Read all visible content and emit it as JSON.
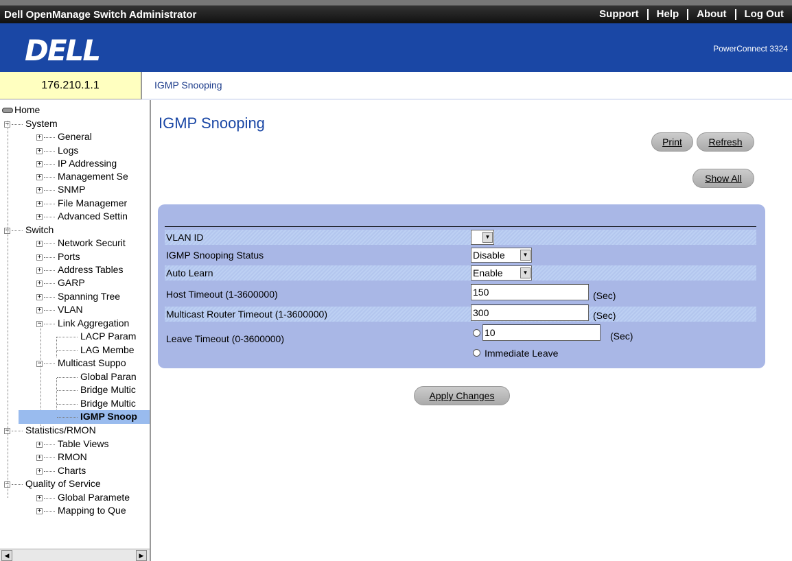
{
  "app": {
    "title": "Dell OpenManage Switch Administrator",
    "nav": [
      "Support",
      "Help",
      "About",
      "Log Out"
    ],
    "logo": "DELL",
    "product": "PowerConnect 3324"
  },
  "ip_address": "176.210.1.1",
  "breadcrumb": "IGMP Snooping",
  "tree": {
    "home": "Home",
    "system": "System",
    "system_items": [
      "General",
      "Logs",
      "IP Addressing",
      "Management Se",
      "SNMP",
      "File Managemer",
      "Advanced Settin"
    ],
    "switch": "Switch",
    "switch_items": [
      "Network Securit",
      "Ports",
      "Address Tables",
      "GARP",
      "Spanning Tree",
      "VLAN"
    ],
    "link_aggregation": "Link Aggregation",
    "link_items": [
      "LACP Param",
      "LAG Membe"
    ],
    "multicast": "Multicast Suppo",
    "multicast_items": [
      "Global Paran",
      "Bridge Multic",
      "Bridge Multic"
    ],
    "selected": "IGMP Snoop",
    "statistics": "Statistics/RMON",
    "stats_items": [
      "Table Views",
      "RMON",
      "Charts"
    ],
    "qos": "Quality of Service",
    "qos_items": [
      "Global Paramete",
      "Mapping to Que"
    ]
  },
  "page": {
    "title": "IGMP Snooping",
    "print": "Print",
    "refresh": "Refresh",
    "show_all": "Show All",
    "apply": "Apply Changes"
  },
  "form": {
    "vlan_id": {
      "label": "VLAN ID",
      "value": ""
    },
    "status": {
      "label": "IGMP Snooping Status",
      "value": "Disable"
    },
    "auto_learn": {
      "label": "Auto Learn",
      "value": "Enable"
    },
    "host_timeout": {
      "label": "Host Timeout (1-3600000)",
      "value": "150",
      "unit": "(Sec)"
    },
    "router_timeout": {
      "label": "Multicast Router Timeout (1-3600000)",
      "value": "300",
      "unit": "(Sec)"
    },
    "leave_timeout": {
      "label": "Leave Timeout (0-3600000)",
      "value": "10",
      "unit": "(Sec)",
      "immediate": "Immediate Leave"
    }
  }
}
